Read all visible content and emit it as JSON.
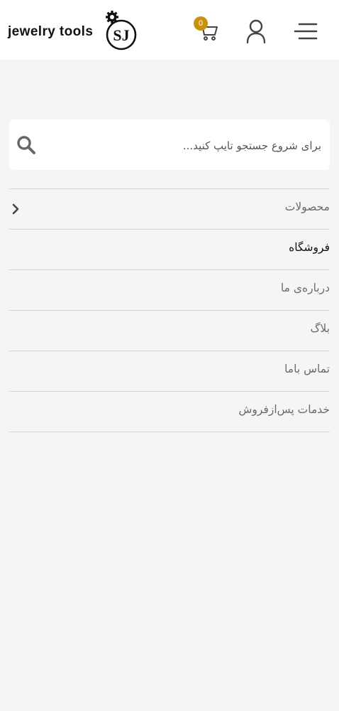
{
  "header": {
    "logo_text": "jewelry tools",
    "logo_monogram": "SJ",
    "cart_count": "0",
    "icons": {
      "cart": "shopping-cart-icon",
      "user": "user-icon",
      "menu": "hamburger-menu-icon"
    }
  },
  "search": {
    "placeholder": "برای شروع جستجو تایپ کنید...",
    "value": "",
    "icon": "search-icon"
  },
  "nav": {
    "items": [
      {
        "label": "محصولات",
        "has_submenu": true
      },
      {
        "label": "فروشگاه",
        "active": true
      },
      {
        "label": "درباره‌ی ما"
      },
      {
        "label": "بلاگ"
      },
      {
        "label": "تماس باما"
      },
      {
        "label": "خدمات پس‌ازفروش"
      }
    ]
  },
  "colors": {
    "accent": "#c9920e",
    "background": "#f5f5f5",
    "header": "#ffffff",
    "divider": "#d8d8d8"
  }
}
